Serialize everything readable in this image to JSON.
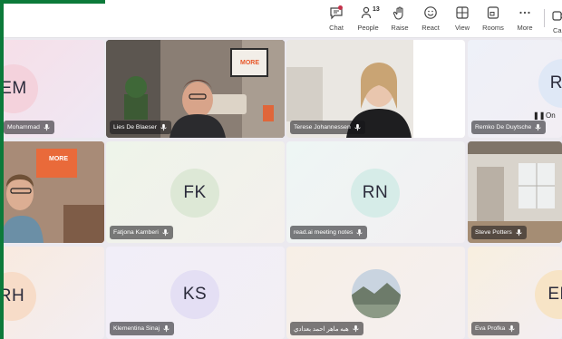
{
  "toolbar": {
    "chat_label": "Chat",
    "people_label": "People",
    "people_count": "13",
    "raise_label": "Raise",
    "react_label": "React",
    "view_label": "View",
    "rooms_label": "Rooms",
    "more_label": "More",
    "camera_label_cut": "Ca"
  },
  "participants": [
    {
      "name": "Mohammad",
      "initials": "EM"
    },
    {
      "name": "Lies De Blaeser"
    },
    {
      "name": "Terese Johannessen"
    },
    {
      "name": "Remko De Duytsche",
      "initials": "RD",
      "status": "On"
    },
    {
      "name": "Fatjona Kamberi",
      "initials": "FK"
    },
    {
      "name": "read.ai meeting notes",
      "initials": "RN"
    },
    {
      "name": "Steve Potters"
    },
    {
      "initials": "RH"
    },
    {
      "name": "Klementina Sinaj",
      "initials": "KS"
    },
    {
      "name": "هبه ماهر احمد بعدادي"
    },
    {
      "name": "Eva Profka",
      "initials": "EF"
    }
  ],
  "poster_text": "MORE",
  "colors": {
    "accent": "#6264a7",
    "brand_green": "#0c7a3a",
    "notify": "#c4314b"
  }
}
